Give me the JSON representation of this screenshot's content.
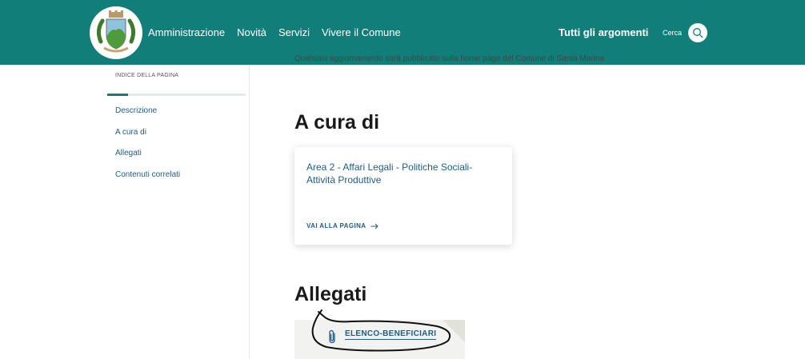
{
  "header": {
    "nav": [
      "Amministrazione",
      "Novità",
      "Servizi",
      "Vivere il Comune"
    ],
    "topics_label": "Tutti gli argomenti",
    "search_label": "Cerca",
    "logo_icon": "coat-of-arms-icon",
    "search_icon": "search-icon",
    "bg_color": "#127e7a"
  },
  "sidebar": {
    "title": "INDICE DELLA PAGINA",
    "progress": 0.15,
    "items": [
      "Descrizione",
      "A cura di",
      "Allegati",
      "Contenuti correlati"
    ]
  },
  "main": {
    "clipped_text": "Qualsiasi aggiornamento sarà pubblicato sulla home page del Comune di Santa Marina",
    "section_acura": {
      "title": "A cura di",
      "card_title": "Area 2 - Affari Legali - Politiche Sociali- Attività Produttive",
      "card_link": "VAI ALLA PAGINA",
      "card_link_icon": "arrow-right-icon"
    },
    "section_allegati": {
      "title": "Allegati",
      "attachment_label": "ELENCO-BENEFICIARI",
      "attachment_icon": "paperclip-icon"
    }
  },
  "colors": {
    "primary": "#127e7a",
    "link": "#1f5c86"
  }
}
